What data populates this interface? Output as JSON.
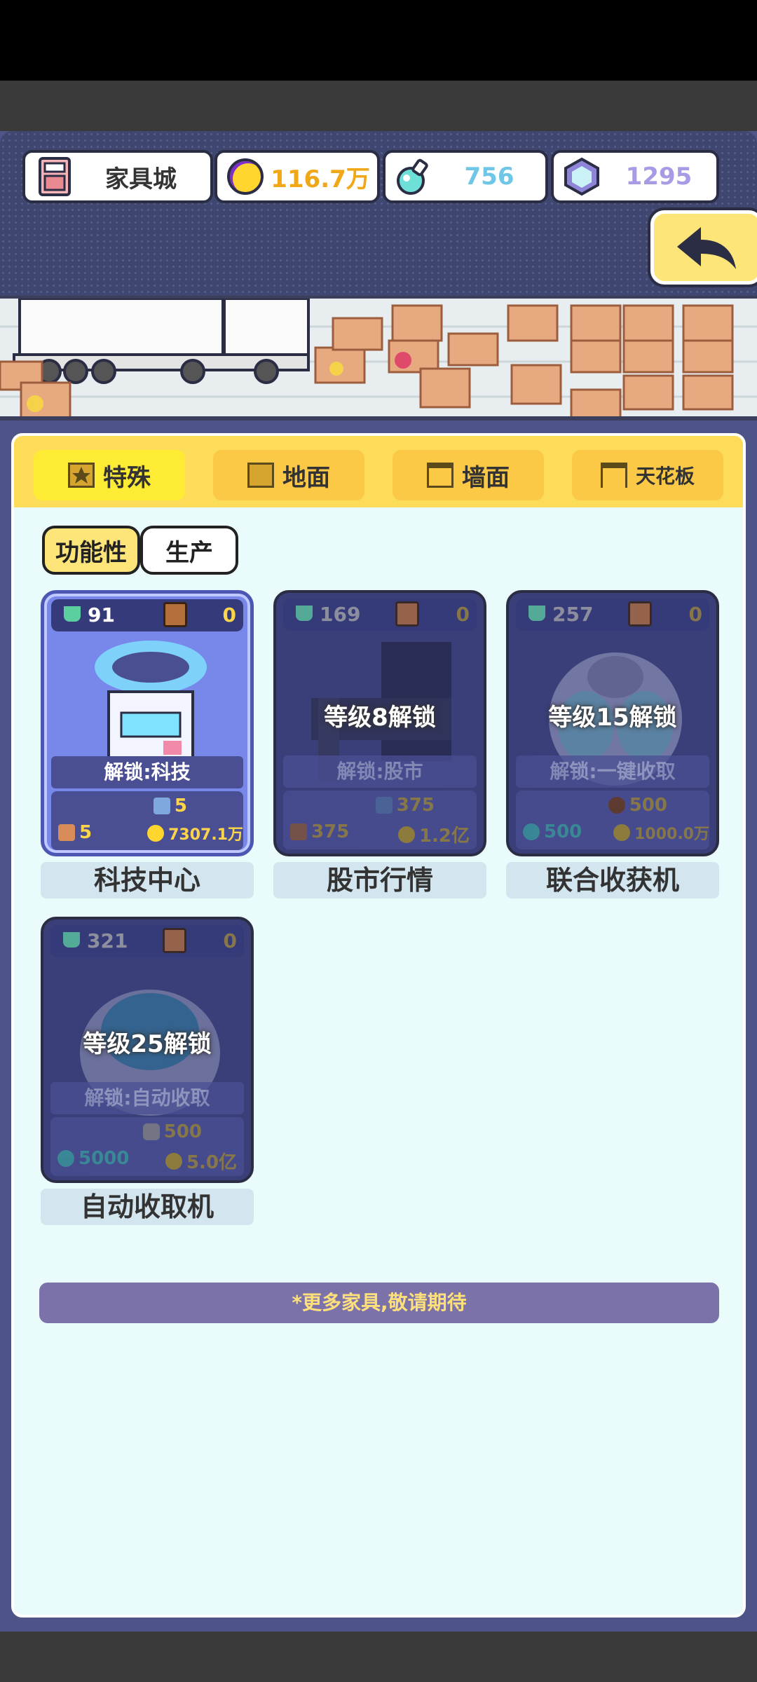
{
  "header": {
    "store_name": "家具城",
    "gold": "116.7万",
    "potion": "756",
    "gem": "1295"
  },
  "tabs": [
    {
      "label": "特殊",
      "active": true
    },
    {
      "label": "地面",
      "active": false
    },
    {
      "label": "墙面",
      "active": false
    },
    {
      "label": "天花板",
      "active": false
    }
  ],
  "subtabs": [
    {
      "label": "功能性",
      "active": true
    },
    {
      "label": "生产",
      "active": false
    }
  ],
  "cards": [
    {
      "name": "科技中心",
      "level": "91",
      "count": "0",
      "unlock": "解锁:科技",
      "lock_msg": "",
      "cost_top": "5",
      "cost_left": "5",
      "cost_right": "7307.1万"
    },
    {
      "name": "股市行情",
      "level": "169",
      "count": "0",
      "unlock": "解锁:股市",
      "lock_msg": "等级8解锁",
      "cost_top": "375",
      "cost_left": "375",
      "cost_right": "1.2亿"
    },
    {
      "name": "联合收获机",
      "level": "257",
      "count": "0",
      "unlock": "解锁:一键收取",
      "lock_msg": "等级15解锁",
      "cost_top": "500",
      "cost_left": "500",
      "cost_right": "1000.0万"
    },
    {
      "name": "自动收取机",
      "level": "321",
      "count": "0",
      "unlock": "解锁:自动收取",
      "lock_msg": "等级25解锁",
      "cost_top": "500",
      "cost_left": "5000",
      "cost_right": "5.0亿"
    }
  ],
  "footer_note": "*更多家具,敬请期待",
  "colors": {
    "gold_text": "#f0a718",
    "potion_text": "#6ec7e6",
    "gem_text": "#a89ae4",
    "tab_active": "#fdeb34",
    "footer_text": "#fde07c"
  }
}
